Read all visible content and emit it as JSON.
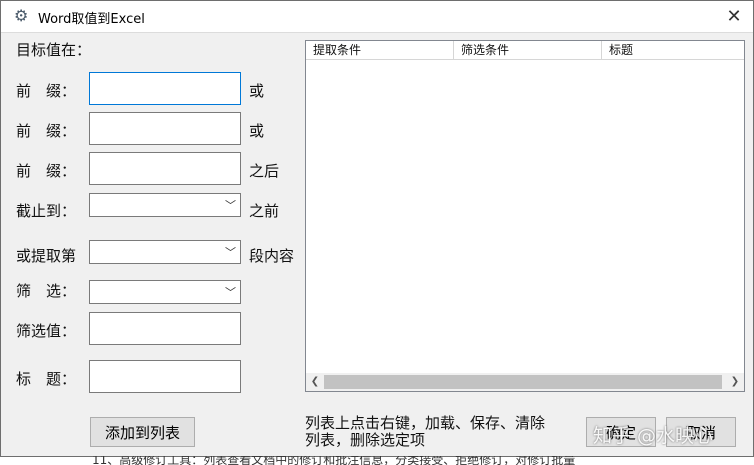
{
  "window": {
    "title": "Word取值到Excel",
    "close_glyph": "✕"
  },
  "form": {
    "target_label": "目标值在：",
    "rows": [
      {
        "label": "前　缀：",
        "value": "",
        "suffix": "或"
      },
      {
        "label": "前　缀：",
        "value": "",
        "suffix": "或"
      },
      {
        "label": "前　缀：",
        "value": "",
        "suffix": "之后"
      },
      {
        "label": "截止到：",
        "value": "",
        "suffix": "之前"
      }
    ],
    "extract_label": "或提取第",
    "extract_value": "",
    "extract_suffix": "段内容",
    "filter_label": "筛　选：",
    "filter_value": "",
    "filter_value_label": "筛选值：",
    "filter_value_text": "",
    "title_label": "标　题：",
    "title_text": ""
  },
  "list": {
    "columns": [
      "提取条件",
      "筛选条件",
      "标题"
    ]
  },
  "footer": {
    "add_button": "添加到列表",
    "hint_line1": "列表上点击右键，加载、保存、清除",
    "hint_line2": "列表，删除选定项",
    "ok_button": "确定",
    "cancel_button": "取消",
    "watermark": "知乎 @水映心"
  },
  "background_text": "11、高级修订工具：列表查看文档中的修订和批注信息，分类接受、拒绝修订，对修订批量"
}
